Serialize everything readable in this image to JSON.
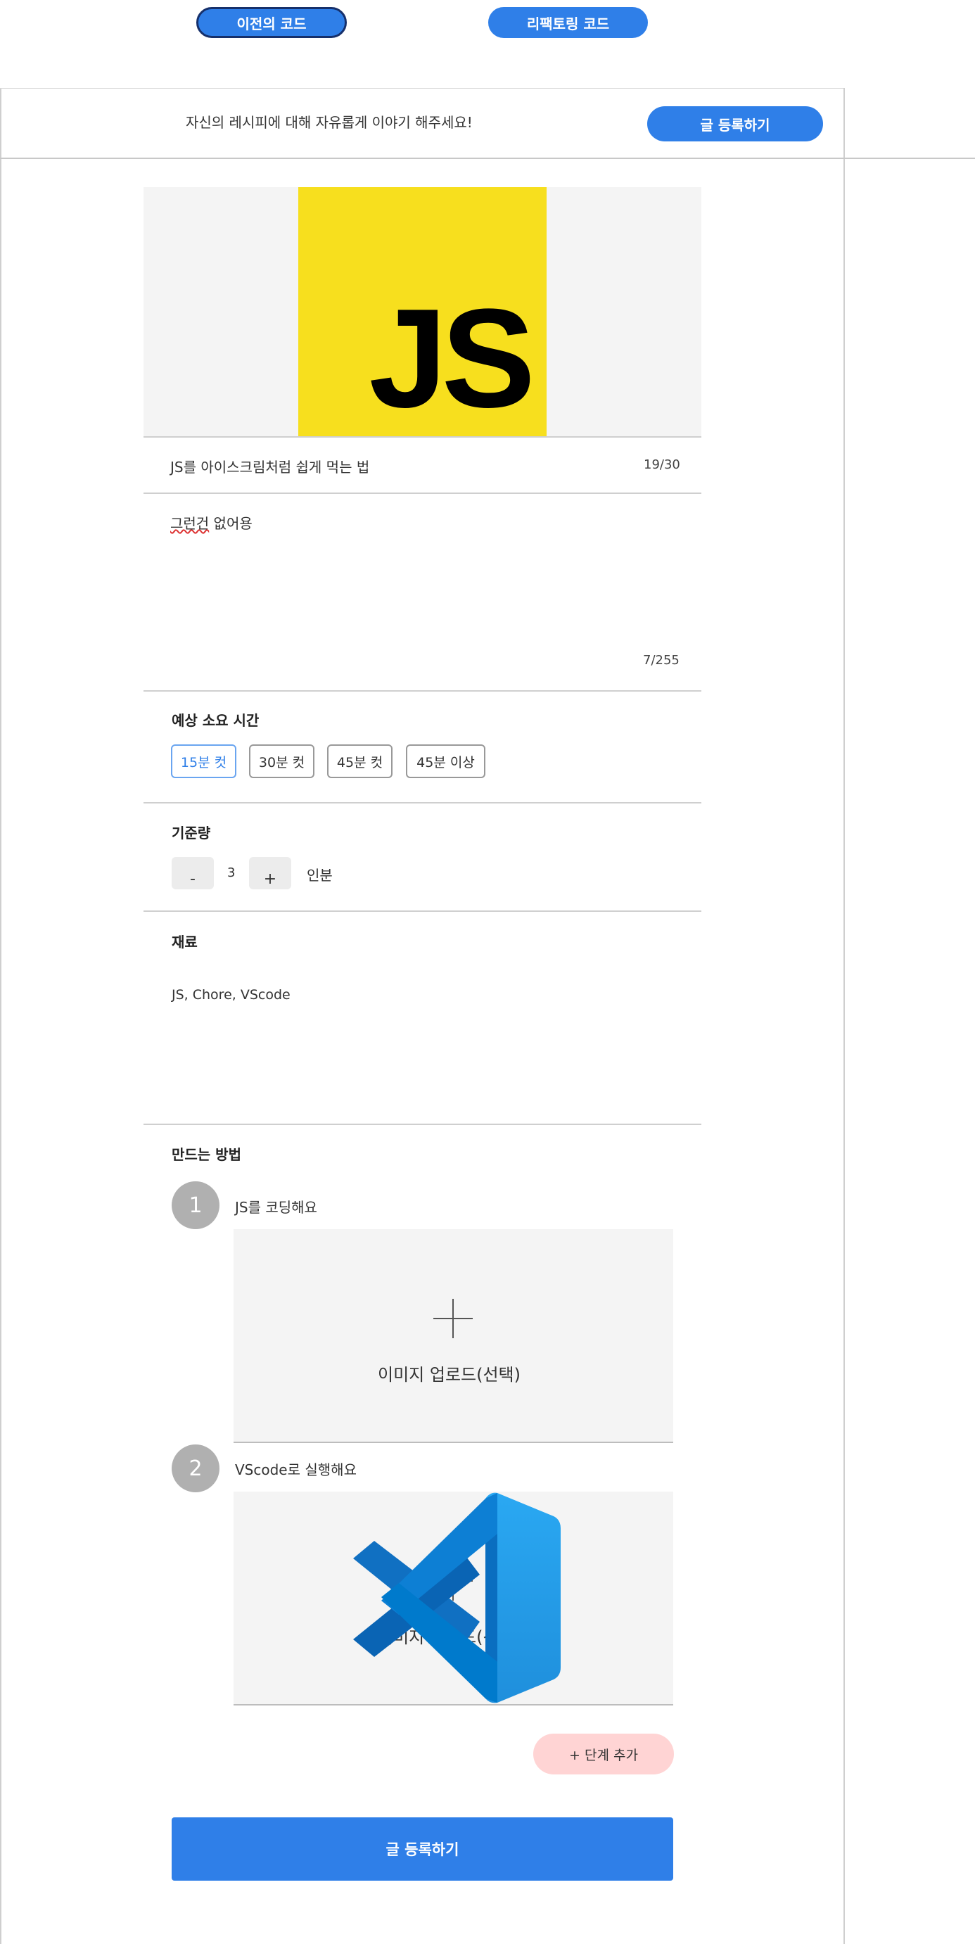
{
  "top_toggle": {
    "prev_label": "이전의 코드",
    "refactor_label": "리팩토링 코드"
  },
  "header": {
    "prompt": "자신의 레시피에 대해 자유롭게 이야기 해주세요!",
    "submit_label": "글 등록하기"
  },
  "recipe": {
    "image_text": "JS",
    "title_value": "JS를 아이스크림처럼 쉽게 먹는 법",
    "title_counter": "19/30",
    "desc_word_misspelled": "그런건",
    "desc_rest": " 없어용",
    "desc_counter": "7/255"
  },
  "time": {
    "label": "예상 소요 시간",
    "options": [
      "15분 컷",
      "30분 컷",
      "45분 컷",
      "45분 이상"
    ],
    "selected": "15분 컷"
  },
  "servings": {
    "label": "기준량",
    "minus": "-",
    "value": "3",
    "plus": "+",
    "unit": "인분"
  },
  "ingredients": {
    "label": "재료",
    "value": "JS, Chore, VScode"
  },
  "steps": {
    "label": "만드는 방법",
    "items": [
      {
        "number": "1",
        "text": "JS를 코딩해요",
        "upload_label": "이미지 업로드(선택)"
      },
      {
        "number": "2",
        "text": "VScode로 실행해요",
        "upload_label": "이미지 업로드(선택)"
      }
    ],
    "add_step_label": "+ 단계 추가"
  },
  "footer": {
    "submit_label": "글 등록하기"
  },
  "colors": {
    "primary": "#2f7fe8",
    "js_yellow": "#f7df1e",
    "add_step_bg": "#ffd4d4",
    "vscode_blue": "#0078d4"
  }
}
